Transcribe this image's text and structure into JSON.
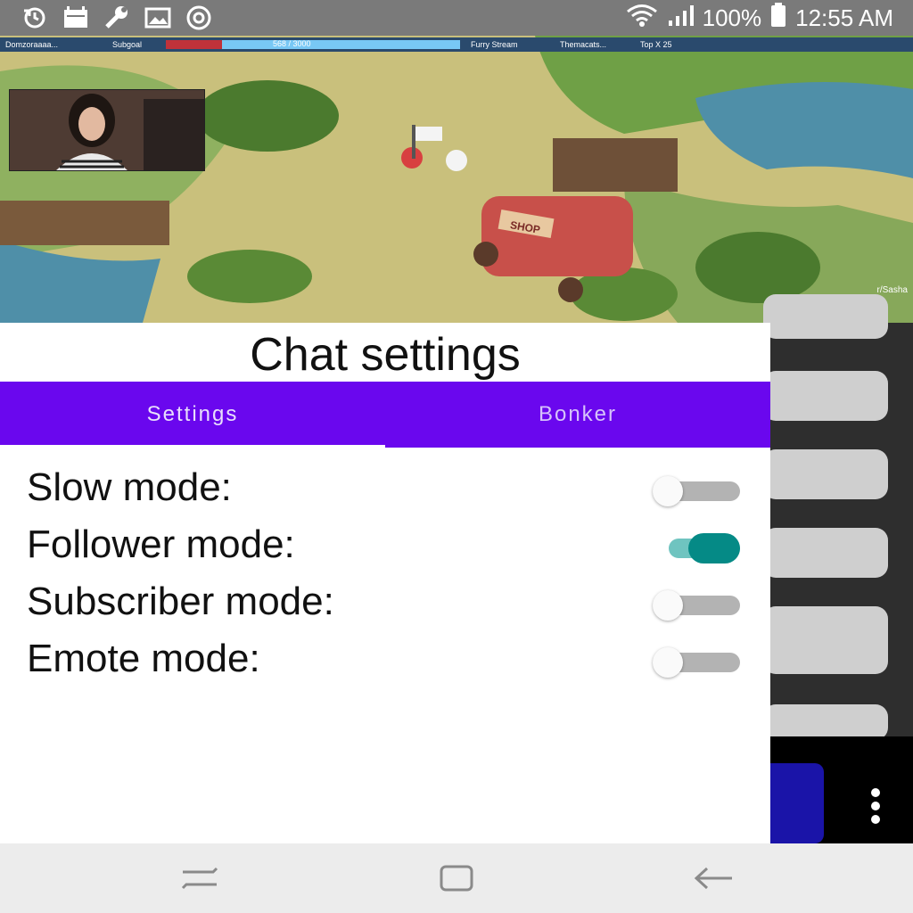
{
  "status_bar": {
    "battery": "100%",
    "time": "12:55 AM",
    "icons_left": [
      "sync-icon",
      "calendar-icon",
      "wrench-icon",
      "image-icon",
      "target-icon"
    ],
    "icons_right": [
      "wifi-icon",
      "signal-icon",
      "battery-icon"
    ]
  },
  "stream": {
    "overlay": {
      "segments": [
        "Domzoraaaa...",
        "Subgoal",
        "Furry Stream",
        "Themacats...",
        "Top X 25"
      ],
      "goal_text": "568 / 3000",
      "goal_fraction": 0.19
    },
    "corner_text": "r/Sasha",
    "shop_sign": "SHOP"
  },
  "panel": {
    "title": "Chat settings",
    "tabs": [
      {
        "label": "Settings",
        "selected": true
      },
      {
        "label": "Bonker",
        "selected": false
      }
    ],
    "settings": [
      {
        "label": "Slow mode:",
        "enabled": false
      },
      {
        "label": "Follower mode:",
        "enabled": true
      },
      {
        "label": "Subscriber mode:",
        "enabled": false
      },
      {
        "label": "Emote mode:",
        "enabled": false
      }
    ]
  },
  "navbar": {
    "buttons": [
      "recents-icon",
      "home-icon",
      "back-icon"
    ]
  },
  "colors": {
    "tab_bar": "#6a07ee",
    "toggle_on": "#058a86",
    "toggle_on_track": "#6fc4c0",
    "status_bar": "#7a7a7a"
  }
}
